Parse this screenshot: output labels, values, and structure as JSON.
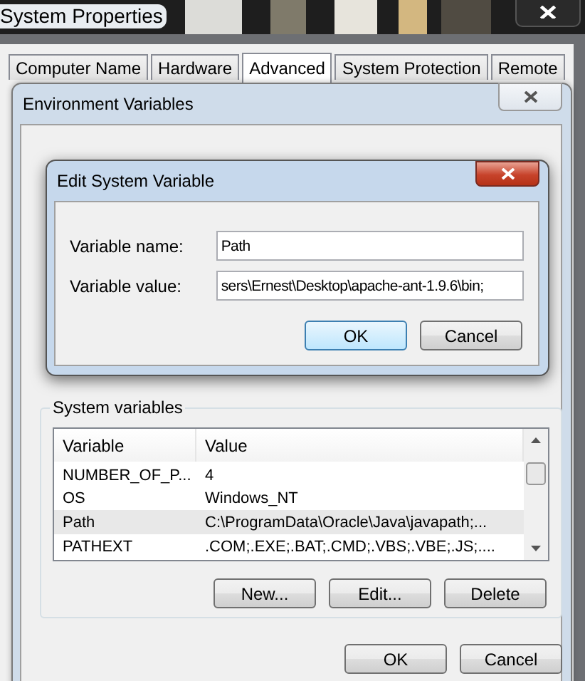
{
  "window": {
    "title": "System Properties"
  },
  "tabs": [
    {
      "label": "Computer Name",
      "selected": false
    },
    {
      "label": "Hardware",
      "selected": false
    },
    {
      "label": "Advanced",
      "selected": true
    },
    {
      "label": "System Protection",
      "selected": false
    },
    {
      "label": "Remote",
      "selected": false
    }
  ],
  "env_dialog": {
    "title": "Environment Variables",
    "system_variables": {
      "label": "System variables",
      "columns": [
        "Variable",
        "Value"
      ],
      "rows": [
        {
          "variable": "NUMBER_OF_P...",
          "value": "4",
          "selected": false
        },
        {
          "variable": "OS",
          "value": "Windows_NT",
          "selected": false
        },
        {
          "variable": "Path",
          "value": "C:\\ProgramData\\Oracle\\Java\\javapath;...",
          "selected": true
        },
        {
          "variable": "PATHEXT",
          "value": ".COM;.EXE;.BAT;.CMD;.VBS;.VBE;.JS;....",
          "selected": false
        }
      ],
      "buttons": [
        "New...",
        "Edit...",
        "Delete"
      ]
    },
    "buttons": [
      "OK",
      "Cancel"
    ]
  },
  "edit_dialog": {
    "title": "Edit System Variable",
    "fields": [
      {
        "label": "Variable name:",
        "value": "Path"
      },
      {
        "label": "Variable value:",
        "value": "sers\\Ernest\\Desktop\\apache-ant-1.9.6\\bin;"
      }
    ],
    "buttons": [
      {
        "label": "OK",
        "default": true
      },
      {
        "label": "Cancel",
        "default": false
      }
    ]
  }
}
